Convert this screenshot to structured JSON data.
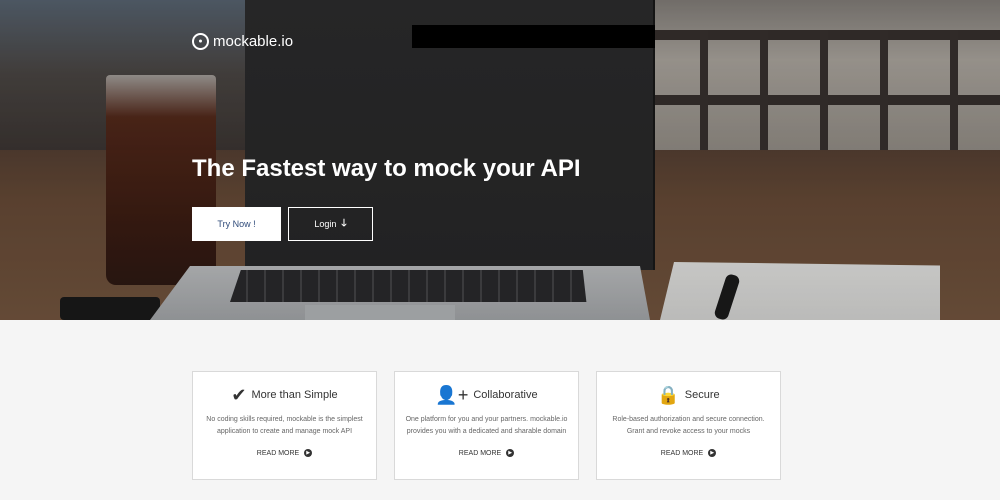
{
  "brand": {
    "name": "mockable.io",
    "icon": "broadcast-icon"
  },
  "hero": {
    "headline": "The Fastest way to mock your API",
    "try_label": "Try Now !",
    "login_label": "Login",
    "login_icon": "arrow-down-icon",
    "login_icon_glyph": "🡓"
  },
  "colors": {
    "hero_text": "#ffffff",
    "try_text": "#2f4b7a",
    "page_bg": "#f5f5f5"
  },
  "features": [
    {
      "title": "More than Simple",
      "icon": "checkmark-icon",
      "glyph": "✔",
      "text": "No coding skills required, mockable is the simplest application to create and manage mock API",
      "link": "READ MORE"
    },
    {
      "title": "Collaborative",
      "icon": "user-plus-icon",
      "glyph": "👤+",
      "text": "One platform for you and your partners. mockable.io provides you with a dedicated and sharable domain",
      "link": "READ MORE"
    },
    {
      "title": "Secure",
      "icon": "lock-icon",
      "glyph": "🔒",
      "text": "Role-based authorization and secure connection. Grant and revoke access to your mocks",
      "link": "READ MORE"
    }
  ]
}
